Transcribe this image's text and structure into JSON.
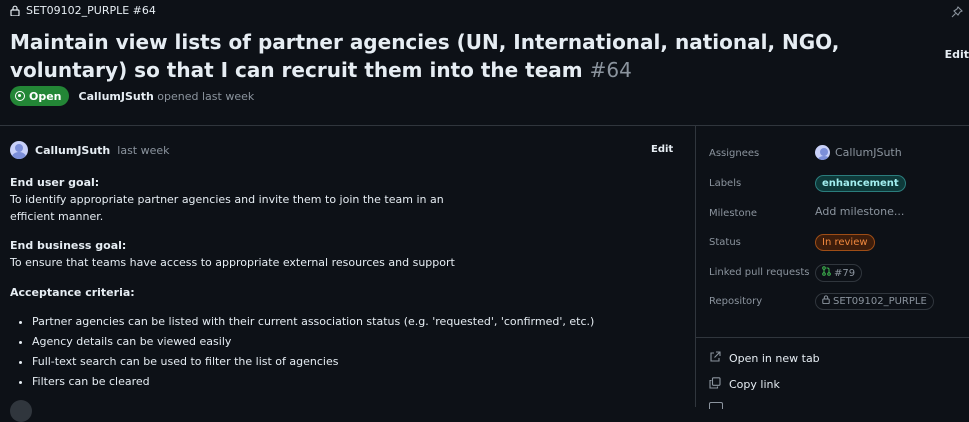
{
  "header": {
    "repo_ref": "SET09102_PURPLE #64",
    "title": "Maintain view lists of partner agencies (UN, International, national, NGO, voluntary) so that I can recruit them into the team",
    "number": "#64",
    "edit_label": "Edit",
    "state_label": "Open",
    "author": "CallumJSuth",
    "opened_text": "opened last week"
  },
  "comment": {
    "author": "CallumJSuth",
    "time": "last week",
    "edit_label": "Edit",
    "goal_user_heading": "End user goal:",
    "goal_user_text": "To identify appropriate partner agencies and invite them to join the team in an efficient manner.",
    "goal_business_heading": "End business goal:",
    "goal_business_text": "To ensure that teams have access to appropriate external resources and support",
    "criteria_heading": "Acceptance criteria:",
    "criteria": [
      "Partner agencies can be listed with their current association status (e.g. 'requested', 'confirmed', etc.)",
      "Agency details can be viewed easily",
      "Full-text search can be used to filter the list of agencies",
      "Filters can be cleared"
    ]
  },
  "sidebar": {
    "assignees_label": "Assignees",
    "assignee": "CallumJSuth",
    "labels_label": "Labels",
    "label_value": "enhancement",
    "milestone_label": "Milestone",
    "milestone_value": "Add milestone...",
    "status_label": "Status",
    "status_value": "In review",
    "linked_pr_label": "Linked pull requests",
    "linked_pr_value": "#79",
    "repository_label": "Repository",
    "repository_value": "SET09102_PURPLE",
    "actions": {
      "open_new_tab": "Open in new tab",
      "copy_link": "Copy link"
    }
  },
  "colors": {
    "background": "#0d1117",
    "open_green": "#238636",
    "label_enhancement": "#a2eeef",
    "status_review": "#f0883e"
  }
}
